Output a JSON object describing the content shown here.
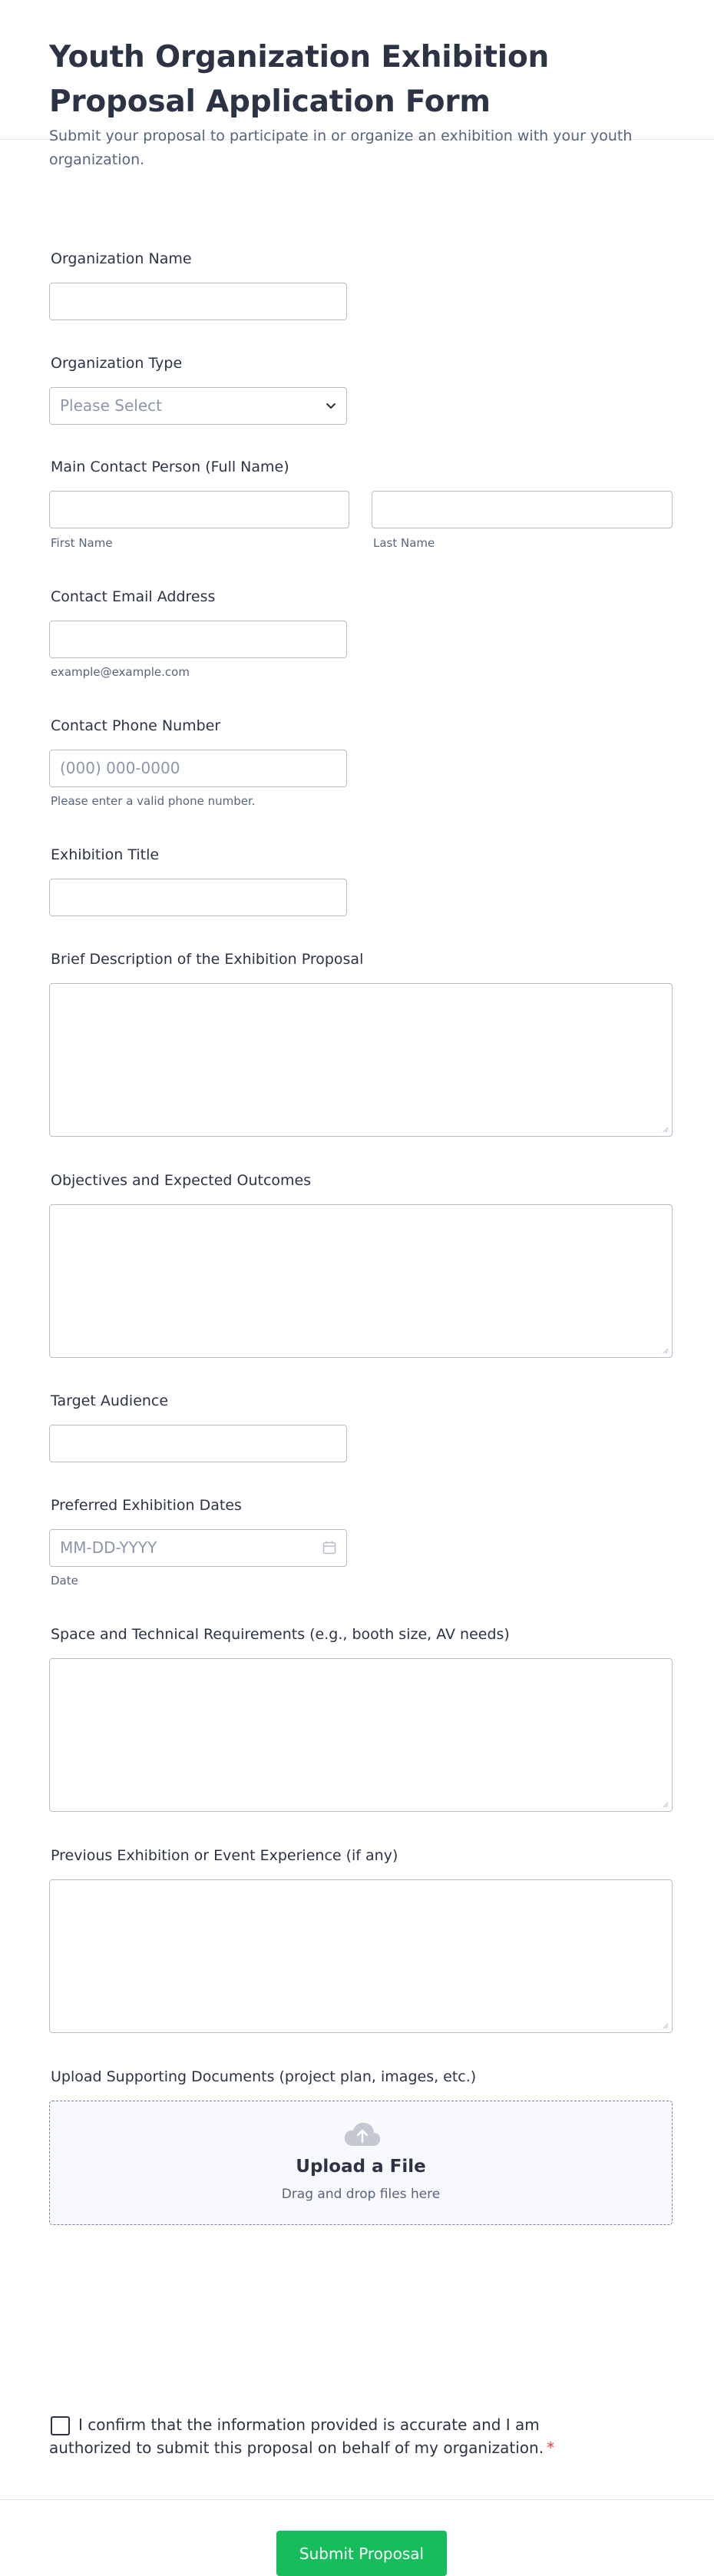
{
  "header": {
    "title": "Youth Organization Exhibition Proposal Application Form",
    "subtitle": "Submit your proposal to participate in or organize an exhibition with your youth organization."
  },
  "fields": {
    "org_name": {
      "label": "Organization Name",
      "value": ""
    },
    "org_type": {
      "label": "Organization Type",
      "placeholder": "Please Select"
    },
    "contact_person": {
      "label": "Main Contact Person (Full Name)",
      "first_sublabel": "First Name",
      "last_sublabel": "Last Name"
    },
    "email": {
      "label": "Contact Email Address",
      "sublabel": "example@example.com"
    },
    "phone": {
      "label": "Contact Phone Number",
      "placeholder": "(000) 000-0000",
      "sublabel": "Please enter a valid phone number."
    },
    "exhibition_title": {
      "label": "Exhibition Title"
    },
    "description": {
      "label": "Brief Description of the Exhibition Proposal"
    },
    "objectives": {
      "label": "Objectives and Expected Outcomes"
    },
    "audience": {
      "label": "Target Audience"
    },
    "dates": {
      "label": "Preferred Exhibition Dates",
      "placeholder": "MM-DD-YYYY",
      "sublabel": "Date"
    },
    "requirements": {
      "label": "Space and Technical Requirements (e.g., booth size, AV needs)"
    },
    "experience": {
      "label": "Previous Exhibition or Event Experience (if any)"
    },
    "upload": {
      "label": "Upload Supporting Documents (project plan, images, etc.)",
      "title": "Upload a File",
      "hint": "Drag and drop files here"
    },
    "confirm": {
      "text": "I confirm that the information provided is accurate and I am authorized to submit this proposal on behalf of my organization.",
      "required_mark": "*"
    }
  },
  "submit_label": "Submit Proposal",
  "colors": {
    "submit": "#18bd5b",
    "required": "#f23a3c",
    "text": "#2c3345",
    "muted": "#57647e"
  }
}
